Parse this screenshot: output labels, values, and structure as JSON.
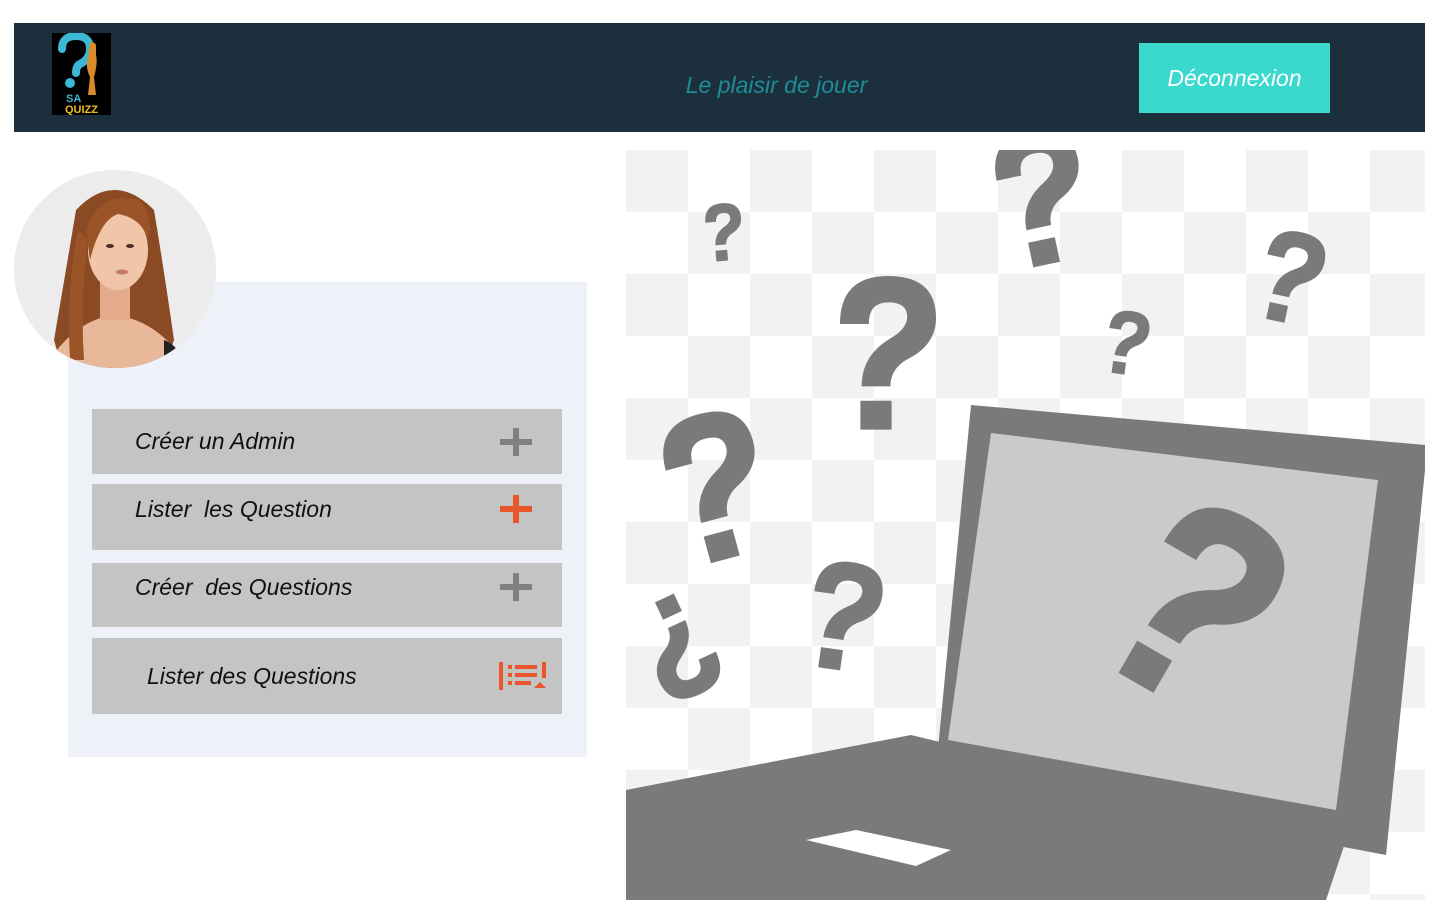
{
  "header": {
    "logo": {
      "icon": "quiz-logo-icon",
      "line1": "SA",
      "line2": "QUIZZ"
    },
    "tagline": "Le  plaisir de jouer",
    "logout_label": "Déconnexion"
  },
  "profile": {
    "avatar_icon": "user-avatar"
  },
  "menu": {
    "items": [
      {
        "label": "Créer un Admin",
        "icon": "plus-icon",
        "icon_color": "#808080"
      },
      {
        "label": "Lister  les Question",
        "icon": "plus-icon",
        "icon_color": "#e8562b"
      },
      {
        "label": "Créer  des Questions",
        "icon": "plus-icon",
        "icon_color": "#808080"
      },
      {
        "label": "Lister des Questions",
        "icon": "list-icon",
        "icon_color": "#e8562b"
      }
    ]
  },
  "illustration": {
    "icon": "laptop-question-marks-illustration"
  },
  "colors": {
    "header_bg": "#1c2f3d",
    "accent": "#3bd8cd",
    "tagline": "#1d8e98",
    "panel_bg": "#eef1f8",
    "menu_item_bg": "#c4c4c4"
  }
}
